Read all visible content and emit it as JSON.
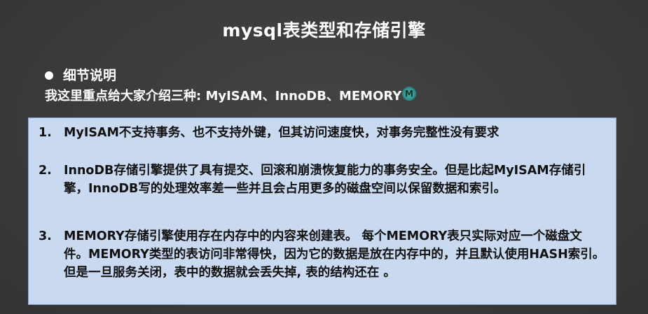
{
  "slide": {
    "title": "mysql表类型和存储引擎",
    "bullet_heading": "细节说明",
    "intro": "我这里重点给大家介绍三种: MyISAM、InnoDB、MEMORY",
    "cursor_label": "M",
    "items": [
      {
        "number": "1.",
        "text": "MyISAM不支持事务、也不支持外键，但其访问速度快，对事务完整性没有要求"
      },
      {
        "number": "2.",
        "text": "InnoDB存储引擎提供了具有提交、回滚和崩溃恢复能力的事务安全。但是比起MyISAM存储引擎，InnoDB写的处理效率差一些并且会占用更多的磁盘空间以保留数据和索引。"
      },
      {
        "number": "3.",
        "text": "MEMORY存储引擎使用存在内存中的内容来创建表。 每个MEMORY表只实际对应一个磁盘文件。MEMORY类型的表访问非常得快，因为它的数据是放在内存中的，并且默认使用HASH索引。但是一旦服务关闭，表中的数据就会丢失掉, 表的结构还在 。"
      }
    ]
  },
  "colors": {
    "background": "#3b3b3b",
    "box_fill": "#c9d9f0",
    "box_border": "#8fa7c8",
    "text_light": "#ffffff",
    "text_dark": "#111111"
  }
}
